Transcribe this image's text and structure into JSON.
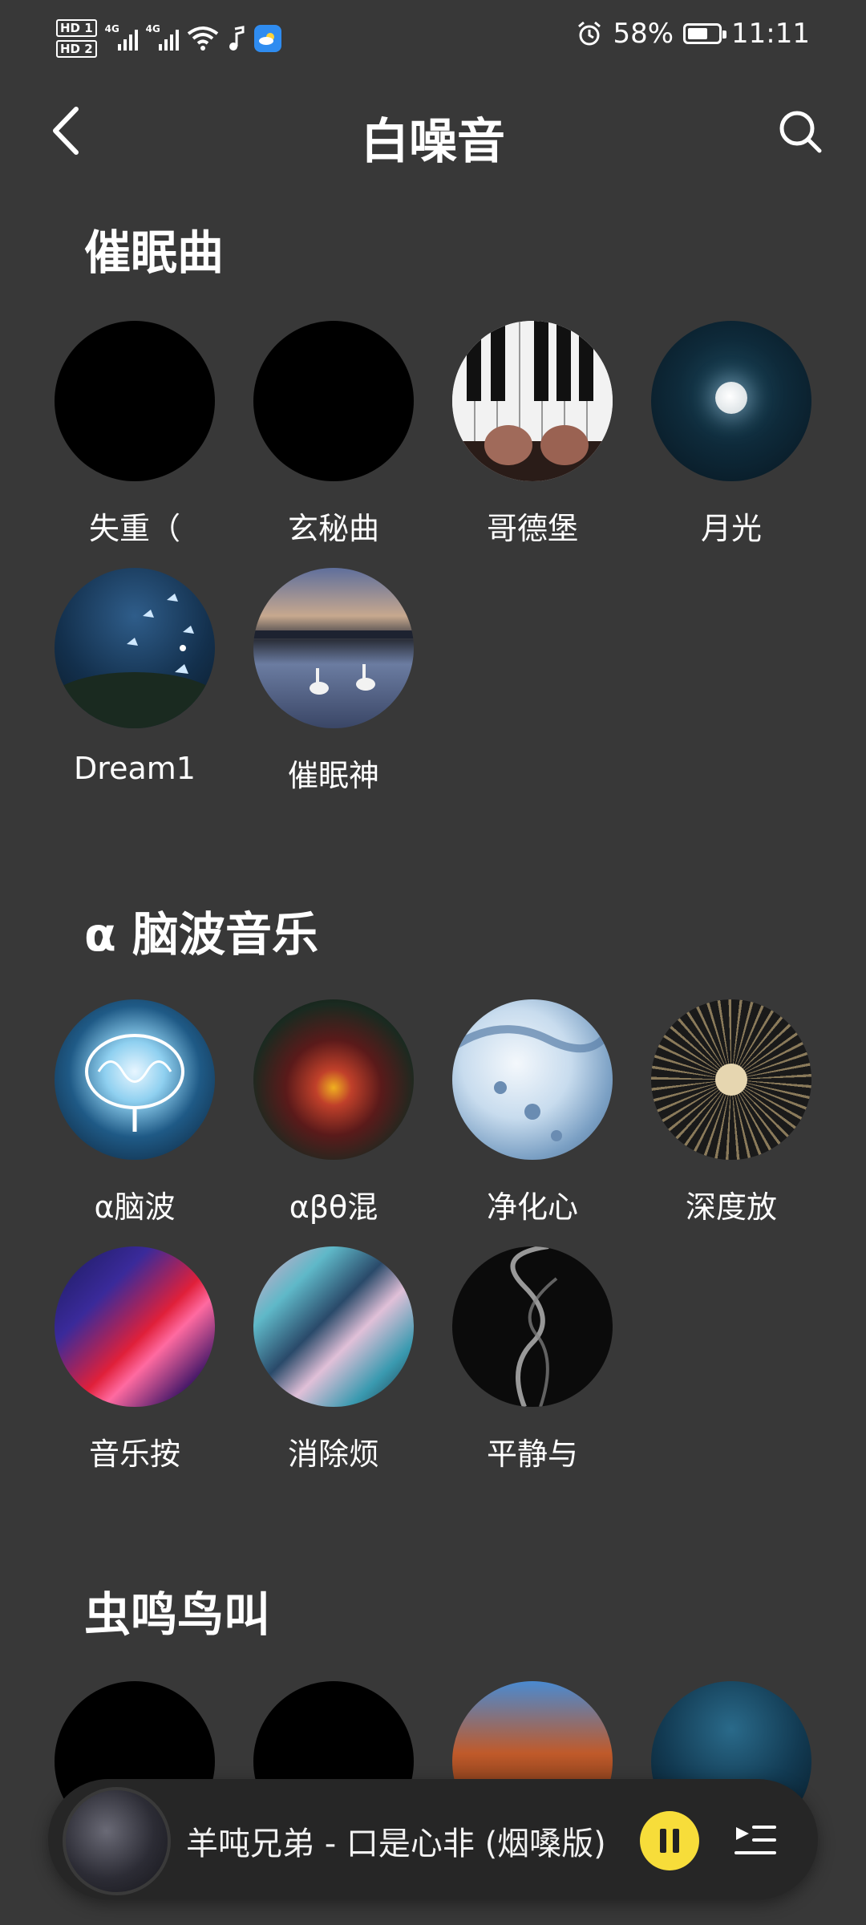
{
  "status_bar": {
    "hd1": "HD 1",
    "hd2": "HD 2",
    "net1": "4G",
    "net2": "4G",
    "battery_percent": "58%",
    "battery_level": 0.58,
    "time": "11:11"
  },
  "header": {
    "title": "白噪音"
  },
  "sections": [
    {
      "title": "催眠曲",
      "items": [
        {
          "label": "失重（"
        },
        {
          "label": "玄秘曲"
        },
        {
          "label": "哥德堡"
        },
        {
          "label": "月光"
        },
        {
          "label": "Dream1"
        },
        {
          "label": "催眠神"
        }
      ]
    },
    {
      "title": "α 脑波音乐",
      "items": [
        {
          "label": "α脑波"
        },
        {
          "label": "αβθ混"
        },
        {
          "label": "净化心"
        },
        {
          "label": "深度放"
        },
        {
          "label": "音乐按"
        },
        {
          "label": "消除烦"
        },
        {
          "label": "平静与"
        }
      ]
    },
    {
      "title": "虫鸣鸟叫",
      "items": [
        {
          "label": ""
        },
        {
          "label": ""
        },
        {
          "label": ""
        },
        {
          "label": ""
        }
      ]
    }
  ],
  "player": {
    "now_playing": "羊吨兄弟 - 口是心非 (烟嗓版)"
  },
  "colors": {
    "background": "#383838",
    "player_bg": "#262626",
    "accent_yellow": "#f7dd3a"
  }
}
